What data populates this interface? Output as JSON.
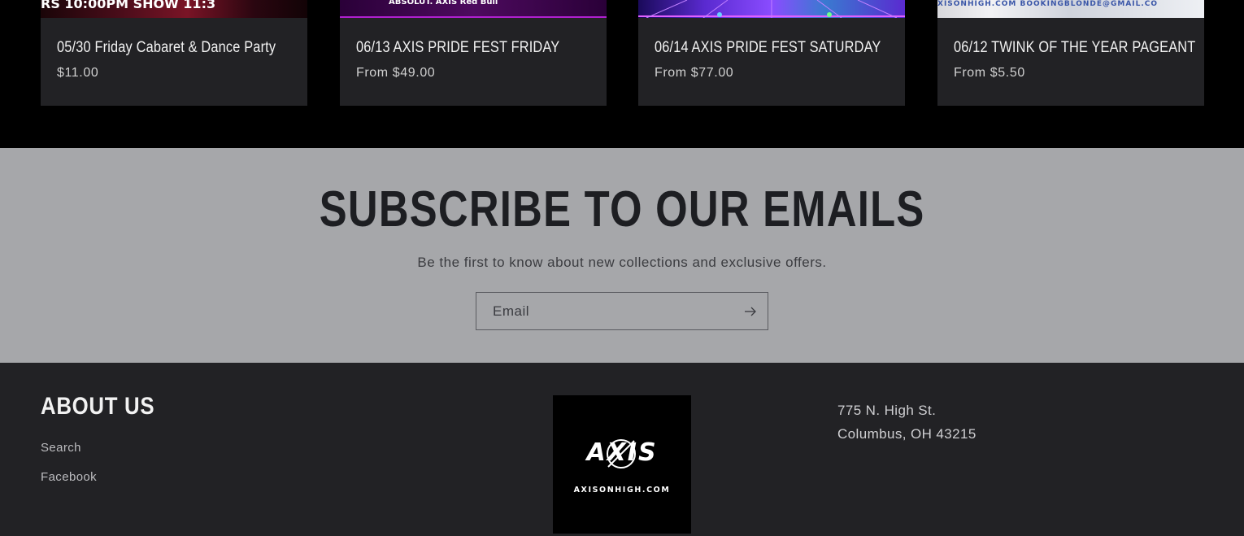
{
  "products": [
    {
      "title": "05/30 Friday Cabaret & Dance Party",
      "price": "$11.00",
      "thumb_text": "RS 10:00PM           SHOW 11:3"
    },
    {
      "title": "06/13 AXIS PRIDE FEST FRIDAY",
      "price": "From $49.00",
      "thumb_text": "ABSOLUT.   AXIS   Red Bull"
    },
    {
      "title": "06/14 AXIS PRIDE FEST SATURDAY",
      "price": "From $77.00",
      "thumb_text": ""
    },
    {
      "title": "06/12 TWINK OF THE YEAR PAGEANT",
      "price": "From $5.50",
      "thumb_text": "XISONHIGH.COM        BOOKINGBLONDE@GMAIL.CO"
    }
  ],
  "subscribe": {
    "title": "SUBSCRIBE TO OUR EMAILS",
    "text": "Be the first to know about new collections and exclusive offers.",
    "email_placeholder": "Email"
  },
  "footer": {
    "about_title": "ABOUT US",
    "links": [
      "Search",
      "Facebook"
    ],
    "logo_text": "AXIS",
    "logo_url_text": "AXISONHIGH.COM",
    "address_line1": "775 N. High St.",
    "address_line2": "Columbus, OH 43215"
  },
  "colors": {
    "page_bg": "#000000",
    "card_bg": "#222225",
    "subscribe_bg": "#a6a7aa",
    "footer_bg": "#222225"
  },
  "icons": {
    "submit": "arrow-right-icon",
    "logo": "axis-logo"
  }
}
